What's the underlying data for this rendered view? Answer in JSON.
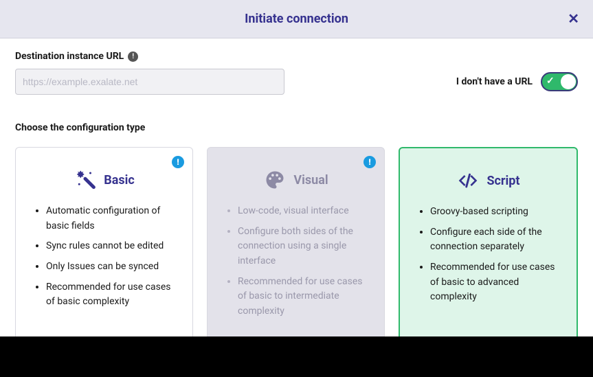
{
  "header": {
    "title": "Initiate connection"
  },
  "url_field": {
    "label": "Destination instance URL",
    "placeholder": "https://example.exalate.net",
    "value": ""
  },
  "no_url": {
    "label": "I don't have a URL",
    "enabled": true
  },
  "config_section": {
    "label": "Choose the configuration type"
  },
  "cards": {
    "basic": {
      "title": "Basic",
      "icon": "wand-icon",
      "features": [
        "Automatic configuration of basic fields",
        "Sync rules cannot be edited",
        "Only Issues can be synced",
        "Recommended for use cases of basic complexity"
      ],
      "has_badge": true,
      "disabled": false,
      "selected": false
    },
    "visual": {
      "title": "Visual",
      "icon": "palette-icon",
      "features": [
        "Low-code, visual interface",
        "Configure both sides of the connection using a single interface",
        "Recommended for use cases of basic to intermediate complexity"
      ],
      "has_badge": true,
      "disabled": true,
      "selected": false
    },
    "script": {
      "title": "Script",
      "icon": "code-icon",
      "features": [
        "Groovy-based scripting",
        "Configure each side of the connection separately",
        "Recommended for use cases of basic to advanced complexity"
      ],
      "has_badge": false,
      "disabled": false,
      "selected": true
    }
  },
  "colors": {
    "accent": "#36328f",
    "success": "#2fb96b",
    "info_badge": "#1a9be0"
  }
}
